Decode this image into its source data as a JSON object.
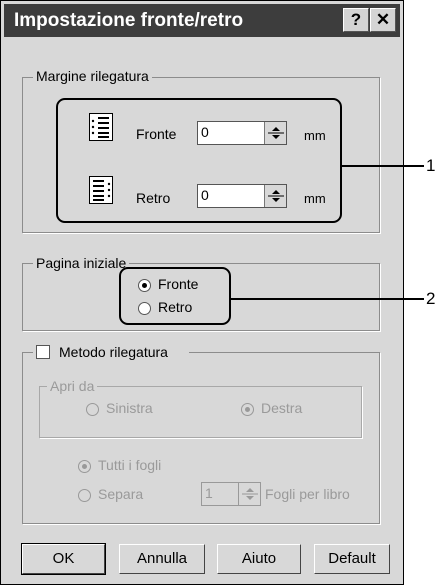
{
  "window": {
    "title": "Impostazione fronte/retro",
    "help_glyph": "?",
    "close_glyph": "✕"
  },
  "binding_margin": {
    "legend": "Margine rilegatura",
    "front_label": "Fronte",
    "front_value": "0",
    "back_label": "Retro",
    "back_value": "0",
    "unit": "mm"
  },
  "start_page": {
    "legend": "Pagina iniziale",
    "options": [
      "Fronte",
      "Retro"
    ],
    "selected": "Fronte"
  },
  "binding_method": {
    "label": "Metodo rilegatura",
    "checked": false,
    "open_from": {
      "legend": "Apri da",
      "options": [
        "Sinistra",
        "Destra"
      ],
      "selected": "Destra"
    },
    "all_sheets_label": "Tutti i fogli",
    "separate_label": "Separa",
    "sheets_value": "1",
    "sheets_per_book_label": "Fogli per libro"
  },
  "buttons": {
    "ok": "OK",
    "cancel": "Annulla",
    "help": "Aiuto",
    "default": "Default"
  },
  "callouts": {
    "one": "1",
    "two": "2"
  }
}
